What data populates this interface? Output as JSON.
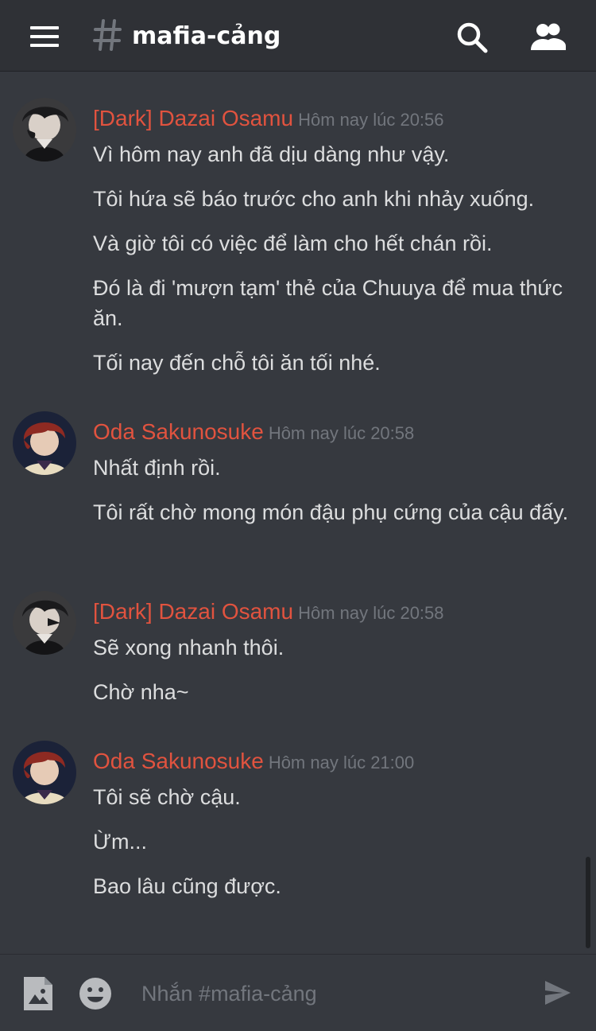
{
  "header": {
    "channel_name": "mafia-cảng"
  },
  "messages": [
    {
      "author": "[Dark] Dazai Osamu",
      "time": "Hôm nay lúc 20:56",
      "lines": [
        "Vì hôm nay anh đã dịu dàng như vậy.",
        "Tôi hứa sẽ báo trước cho anh khi nhảy xuống.",
        "Và giờ tôi có việc để làm cho hết chán rồi.",
        "Đó là đi 'mượn tạm' thẻ của Chuuya để mua thức ăn.",
        "Tối nay đến chỗ tôi ăn tối nhé."
      ]
    },
    {
      "author": "Oda Sakunosuke",
      "time": "Hôm nay lúc 20:58",
      "lines": [
        "Nhất định rồi.",
        "Tôi rất chờ mong món đậu phụ cứng của cậu đấy."
      ]
    },
    {
      "author": "[Dark] Dazai Osamu",
      "time": "Hôm nay lúc 20:58",
      "lines": [
        "Sẽ xong nhanh thôi.",
        "Chờ nha~"
      ]
    },
    {
      "author": "Oda Sakunosuke",
      "time": "Hôm nay lúc 21:00",
      "lines": [
        "Tôi sẽ chờ cậu.",
        "Ừm...",
        "Bao lâu cũng được."
      ]
    }
  ],
  "composer": {
    "placeholder": "Nhắn #mafia-cảng"
  },
  "icons": {
    "menu": "hamburger-menu-icon",
    "channel": "hash-icon",
    "search": "search-icon",
    "members": "members-icon",
    "image": "image-upload-icon",
    "emoji": "emoji-icon",
    "send": "send-icon"
  },
  "colors": {
    "background": "#36393f",
    "header": "#2f3136",
    "author": "#e1533f",
    "timestamp": "#72767d",
    "text": "#dcddde"
  }
}
